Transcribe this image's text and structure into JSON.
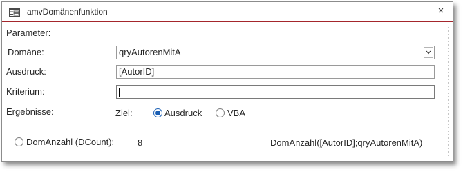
{
  "window": {
    "title": "amvDomänenfunktion",
    "icon": "form-icon",
    "close_label": "×"
  },
  "form": {
    "parameter_label": "Parameter:",
    "domain": {
      "label": "Domäne:",
      "value": "qryAutorenMitA",
      "icon": "chevron-down-icon"
    },
    "expression": {
      "label": "Ausdruck:",
      "value": "[AutorID]"
    },
    "criterion": {
      "label": "Kriterium:",
      "value": ""
    },
    "results": {
      "label": "Ergebnisse:",
      "target_label": "Ziel:",
      "options": [
        {
          "label": "Ausdruck",
          "selected": true
        },
        {
          "label": "VBA",
          "selected": false
        }
      ]
    },
    "result_row": {
      "label": "DomAnzahl (DCount):",
      "value": "8",
      "formula": "DomAnzahl([AutorID];qryAutorenMitA)",
      "selected": false
    }
  },
  "colors": {
    "title_border": "#a4262c",
    "radio_accent": "#1a5fb4"
  }
}
